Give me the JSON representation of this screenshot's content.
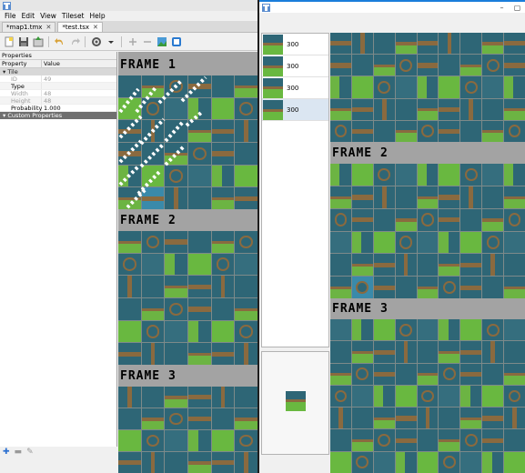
{
  "main_window": {
    "menu": [
      "File",
      "Edit",
      "View",
      "Tileset",
      "Help"
    ],
    "tabs": [
      {
        "label": "*map1.tmx",
        "active": false
      },
      {
        "label": "*test.tsx",
        "active": true
      }
    ],
    "toolbar_icons": [
      "new-icon",
      "save-icon",
      "export-icon",
      "undo-icon",
      "redo-icon",
      "settings-icon",
      "add-icon",
      "remove-icon",
      "edit-image-icon",
      "terrain-icon"
    ]
  },
  "properties": {
    "panel_title": "Properties",
    "col_property": "Property",
    "col_value": "Value",
    "group_tile": "Tile",
    "rows": [
      {
        "key": "ID",
        "value": "49",
        "readonly": true
      },
      {
        "key": "Type",
        "value": "",
        "readonly": false
      },
      {
        "key": "Width",
        "value": "48",
        "readonly": true
      },
      {
        "key": "Height",
        "value": "48",
        "readonly": true
      },
      {
        "key": "Probability",
        "value": "1.000",
        "readonly": false
      }
    ],
    "group_custom": "Custom Properties"
  },
  "tileset_view": {
    "frames": [
      "FRAME 1",
      "FRAME 2",
      "FRAME 3"
    ]
  },
  "animation_editor": {
    "frames": [
      {
        "duration": "300"
      },
      {
        "duration": "300"
      },
      {
        "duration": "300"
      },
      {
        "duration": "300"
      }
    ],
    "selected_frame_index": 3,
    "tile_frames": [
      "FRAME 2",
      "FRAME 3"
    ]
  },
  "colors": {
    "water": "#2e6676",
    "grass": "#69b840",
    "dirt": "#8a6a3f",
    "accent": "#1a7ddb"
  }
}
